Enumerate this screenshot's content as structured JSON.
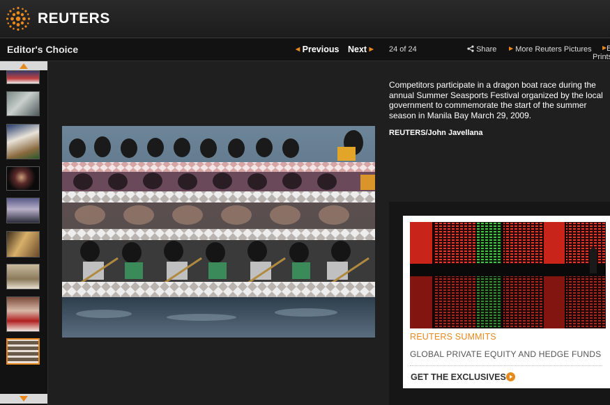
{
  "brand": {
    "name": "REUTERS",
    "logo_icon": "reuters-dot-sphere-icon",
    "accent": "#e8891d"
  },
  "nav": {
    "section_title": "Editor's Choice",
    "previous_label": "Previous",
    "next_label": "Next",
    "counter": "24 of 24",
    "share_label": "Share",
    "more_pictures_label": "More Reuters Pictures",
    "prints_label": "Prints"
  },
  "thumbnails": {
    "count_visible": 9,
    "active_index": 8,
    "scroll_up_icon": "triangle-up-icon",
    "scroll_down_icon": "triangle-down-icon"
  },
  "photo": {
    "caption": "Competitors participate in a dragon boat race during the annual Summer Seasports Festival organized by the local government to commemorate the start of the summer season in Manila Bay March 29, 2009.",
    "credit": "REUTERS/John Javellana"
  },
  "ad": {
    "kicker": "REUTERS SUMMITS",
    "headline": "GLOBAL PRIVATE EQUITY AND HEDGE FUNDS",
    "cta": "GET THE EXCLUSIVES",
    "cta_icon": "circle-play-icon"
  }
}
